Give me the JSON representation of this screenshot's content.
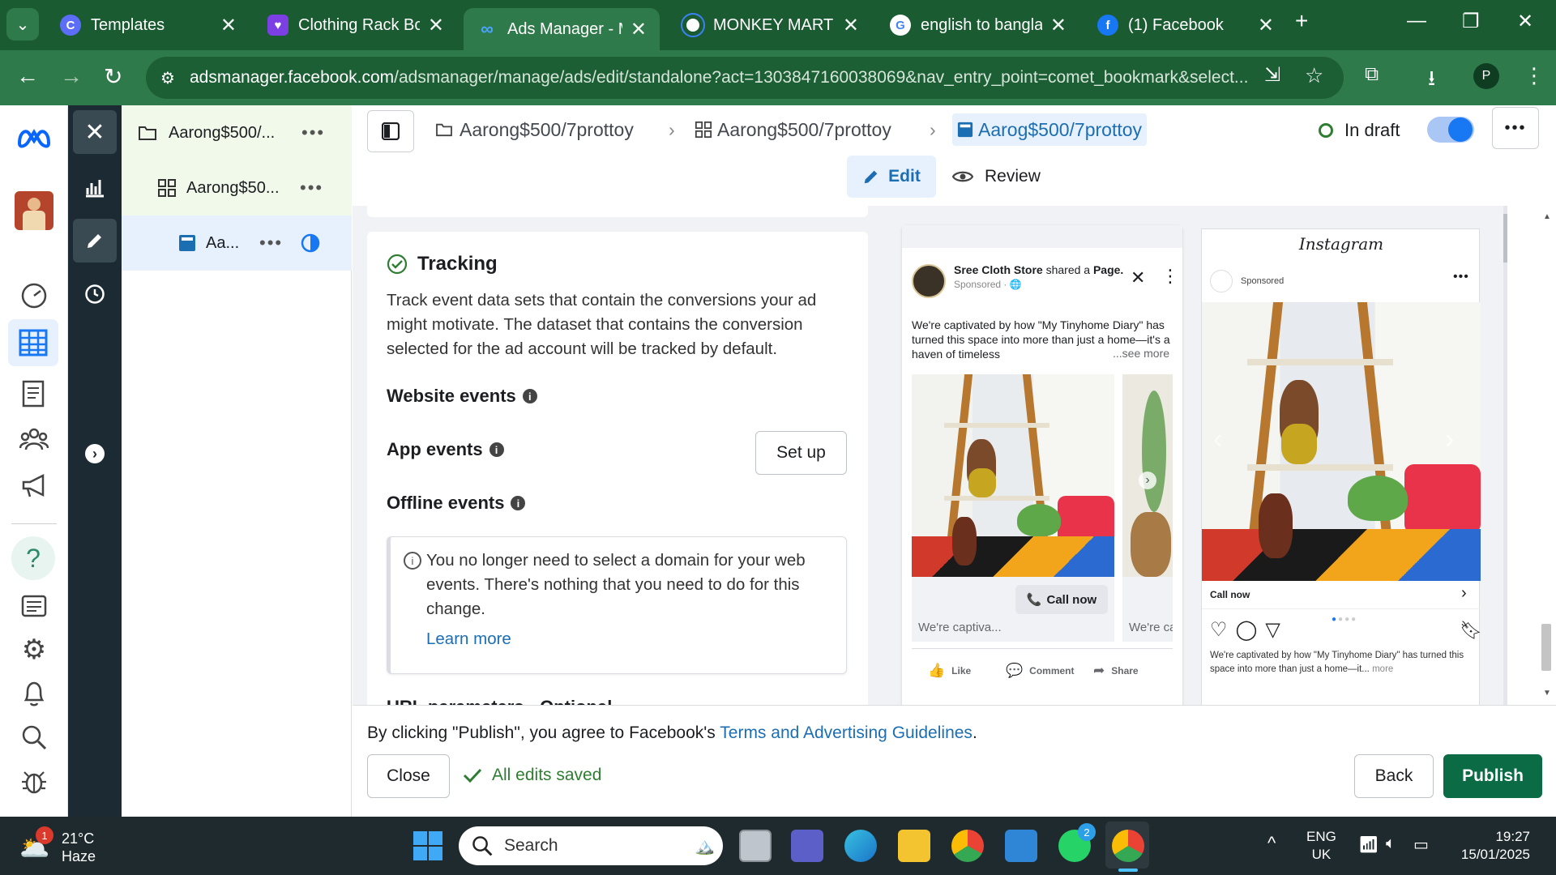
{
  "browser": {
    "tabs": [
      {
        "title": "Templates",
        "favicon": "C"
      },
      {
        "title": "Clothing Rack Bou",
        "favicon": "heart"
      },
      {
        "title": "Ads Manager - Ma",
        "favicon": "meta"
      },
      {
        "title": "MONKEY MART - F",
        "favicon": "circle"
      },
      {
        "title": "english to bangla -",
        "favicon": "G"
      },
      {
        "title": "(1) Facebook",
        "favicon": "f"
      }
    ],
    "url_host": "adsmanager.facebook.com",
    "url_path": "/adsmanager/manage/ads/edit/standalone?act=1303847160038069&nav_entry_point=comet_bookmark&select...",
    "profile_initial": "P"
  },
  "tree": {
    "campaign": "Aarong$500/...",
    "adset": "Aarong$50...",
    "ad": "Aa..."
  },
  "breadcrumb": {
    "campaign": "Aarong$500/7prottoy",
    "adset": "Aarong$500/7prottoy",
    "ad": "Aarog$500/7prottoy"
  },
  "status": {
    "label": "In draft"
  },
  "modes": {
    "edit": "Edit",
    "review": "Review"
  },
  "tracking": {
    "title": "Tracking",
    "description": "Track event data sets that contain the conversions your ad might motivate. The dataset that contains the conversion selected for the ad account will be tracked by default.",
    "website_events": "Website events",
    "app_events": "App events",
    "setup_button": "Set up",
    "offline_events": "Offline events",
    "notice": "You no longer need to select a domain for your web events. There's nothing that you need to do for this change.",
    "learn_more": "Learn more",
    "url_params": "URL parameters · Optional"
  },
  "fb_preview": {
    "page_name": "Sree Cloth Store",
    "shared": "shared a",
    "page_word": "Page.",
    "sponsored": "Sponsored · ",
    "text1": "We're captivated by how \"My Tinyhome Diary\" has turned this space into more than just a home—it's a haven of timeless",
    "see_more": "...see more",
    "call_now": "Call now",
    "caption1": "We're captiva...",
    "caption2": "We're ca",
    "like": "Like",
    "comment": "Comment",
    "share": "Share"
  },
  "ig_preview": {
    "brand": "Instagram",
    "sponsored": "Sponsored",
    "call_now": "Call now",
    "caption": "We're captivated by how \"My Tinyhome Diary\" has turned this space into more than just a home—it...",
    "more": "more"
  },
  "footer": {
    "agreement_prefix": "By clicking \"Publish\", you agree to Facebook's ",
    "agreement_link": "Terms and Advertising Guidelines",
    "agreement_suffix": ".",
    "close": "Close",
    "saved": "All edits saved",
    "back": "Back",
    "publish": "Publish"
  },
  "taskbar": {
    "weather_temp": "21°C",
    "weather_desc": "Haze",
    "weather_badge": "1",
    "search_placeholder": "Search",
    "lang1": "ENG",
    "lang2": "UK",
    "time": "19:27",
    "date": "15/01/2025",
    "whatsapp_badge": "2"
  },
  "colors": {
    "chrome_dark": "#1b5b32",
    "chrome_toolbar": "#2f7a4a",
    "accent_blue": "#1877f2",
    "publish_green": "#0a6b44"
  }
}
